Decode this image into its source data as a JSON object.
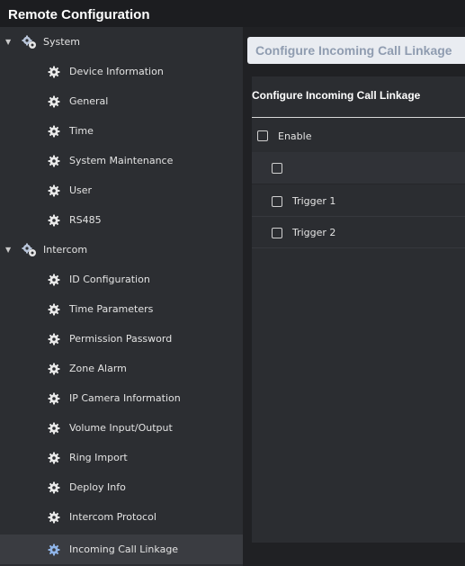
{
  "window": {
    "title": "Remote Configuration"
  },
  "sidebar": {
    "groups": [
      {
        "label": "System",
        "expanded": true,
        "items": [
          "Device Information",
          "General",
          "Time",
          "System Maintenance",
          "User",
          "RS485"
        ]
      },
      {
        "label": "Intercom",
        "expanded": true,
        "items": [
          "ID Configuration",
          "Time Parameters",
          "Permission Password",
          "Zone Alarm",
          "IP Camera Information",
          "Volume Input/Output",
          "Ring Import",
          "Deploy Info",
          "Intercom Protocol",
          "Incoming Call Linkage"
        ]
      }
    ],
    "active_item": "Incoming Call Linkage"
  },
  "content": {
    "tab_title": "Configure Incoming Call Linkage",
    "section_title": "Configure Incoming Call Linkage",
    "enable_label": "Enable",
    "enable_checked": false,
    "header_checked": false,
    "triggers": [
      {
        "label": "Trigger 1",
        "checked": false
      },
      {
        "label": "Trigger 2",
        "checked": false
      }
    ]
  },
  "colors": {
    "title_bar": "#1c1d20",
    "sidebar_bg": "#2c2e32",
    "active_row": "#3a3c41",
    "tab_bg": "#e9ecf1",
    "tab_text": "#8f9cb0",
    "gear_icon": "#e8e8e8",
    "active_gear_icon": "#8fb4e8"
  },
  "icons": {
    "group_icon": "gear-cluster-icon",
    "item_icon": "gear-icon",
    "expanded_caret": "caret-down-icon"
  }
}
